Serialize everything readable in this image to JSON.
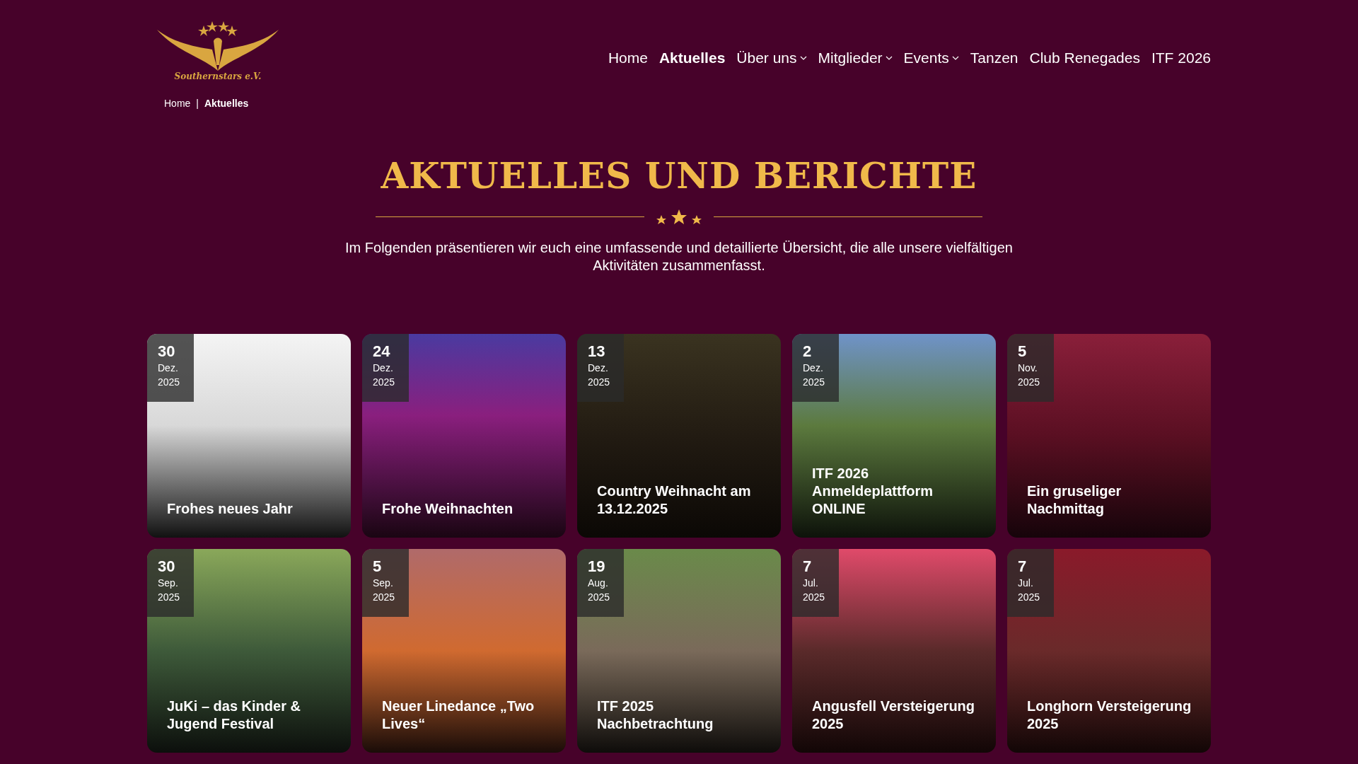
{
  "logo": {
    "text": "Southernstars e.V."
  },
  "nav": [
    {
      "label": "Home",
      "selected": false,
      "kind": "link"
    },
    {
      "label": "Aktuelles",
      "selected": true,
      "kind": "link"
    },
    {
      "label": "Über uns",
      "selected": false,
      "kind": "dropdown"
    },
    {
      "label": "Mitglieder",
      "selected": false,
      "kind": "dropdown"
    },
    {
      "label": "Events",
      "selected": false,
      "kind": "dropdown"
    },
    {
      "label": "Tanzen",
      "selected": false,
      "kind": "link"
    },
    {
      "label": "Club Renegades",
      "selected": false,
      "kind": "link"
    },
    {
      "label": "ITF 2026",
      "selected": false,
      "kind": "link"
    }
  ],
  "breadcrumb": {
    "items": [
      "Home",
      "Aktuelles"
    ],
    "separator": "|"
  },
  "heading": "AKTUELLES UND BERICHTE",
  "intro": "Im Folgenden präsentieren wir euch eine umfassende und detaillierte Übersicht, die alle unsere vielfältigen Aktivitäten zusammenfasst.",
  "posts": [
    {
      "day": "30",
      "month": "Dez.",
      "year": "2025",
      "title": "Frohes neues Jahr"
    },
    {
      "day": "24",
      "month": "Dez.",
      "year": "2025",
      "title": "Frohe Weihnachten"
    },
    {
      "day": "13",
      "month": "Dez.",
      "year": "2025",
      "title": "Country Weihnacht am 13.12.2025"
    },
    {
      "day": "2",
      "month": "Dez.",
      "year": "2025",
      "title": "ITF 2026 Anmeldeplattform ONLINE"
    },
    {
      "day": "5",
      "month": "Nov.",
      "year": "2025",
      "title": "Ein gruseliger Nachmittag"
    },
    {
      "day": "30",
      "month": "Sep.",
      "year": "2025",
      "title": "JuKi – das Kinder & Jugend Festival"
    },
    {
      "day": "5",
      "month": "Sep.",
      "year": "2025",
      "title": "Neuer Linedance „Two Lives“"
    },
    {
      "day": "19",
      "month": "Aug.",
      "year": "2025",
      "title": "ITF 2025 Nachbetrachtung"
    },
    {
      "day": "7",
      "month": "Jul.",
      "year": "2025",
      "title": "Angusfell Versteigerung 2025"
    },
    {
      "day": "7",
      "month": "Jul.",
      "year": "2025",
      "title": "Longhorn Versteigerung 2025"
    }
  ]
}
